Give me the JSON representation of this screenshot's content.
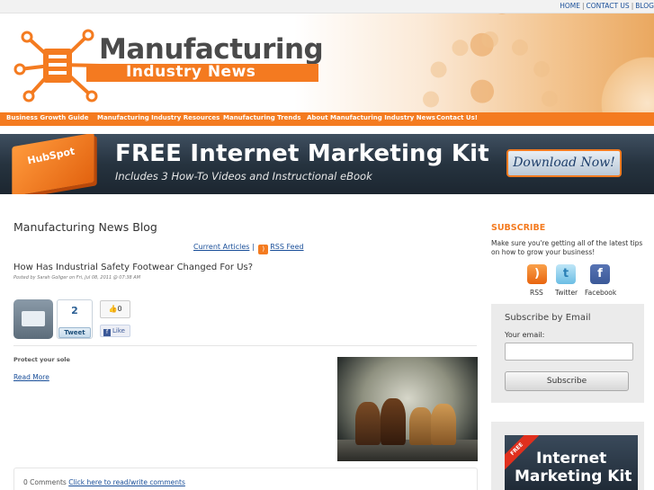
{
  "top_links": {
    "home": "HOME",
    "contact": "CONTACT US",
    "blog": "BLOG",
    "separator": "|"
  },
  "logo": {
    "title": "Manufacturing",
    "subtitle": "Industry News",
    "brand_color": "#f47b20"
  },
  "nav": {
    "items": [
      "Business Growth Guide",
      "Manufacturing Industry Resources",
      "Manufacturing Trends",
      "About Manufacturing Industry News",
      "Contact Us!"
    ]
  },
  "banner": {
    "book_label": "HubSpot",
    "title": "FREE Internet Marketing Kit",
    "subtitle": "Includes 3 How-To Videos and Instructional eBook",
    "button": "Download Now!"
  },
  "main": {
    "title": "Manufacturing News Blog",
    "current_articles": "Current Articles",
    "links_separator": "|",
    "rss_feed": "RSS Feed"
  },
  "post": {
    "title": "How Has Industrial Safety Footwear Changed For Us?",
    "meta": "Posted by Sarah Goliger on Fri, Jul 08, 2011 @ 07:38 AM",
    "tweet_count": "2",
    "tweet_label": "Tweet",
    "like_count": "0",
    "like_label": "Like",
    "excerpt": "Protect your sole",
    "read_more": "Read More",
    "comments_count": "0 Comments",
    "comments_link": "Click here to read/write comments"
  },
  "sidebar": {
    "subscribe_title": "SUBSCRIBE",
    "subscribe_text": "Make sure you're getting all of the latest tips on how to grow your business!",
    "social": [
      {
        "icon": "rss-icon",
        "label": "RSS"
      },
      {
        "icon": "twitter-icon",
        "label": "Twitter"
      },
      {
        "icon": "facebook-icon",
        "label": "Facebook"
      }
    ],
    "email_title": "Subscribe by Email",
    "email_label": "Your email:",
    "email_value": "",
    "subscribe_button": "Subscribe",
    "promo_ribbon": "FREE",
    "promo_line1": "Internet",
    "promo_line2": "Marketing Kit"
  }
}
